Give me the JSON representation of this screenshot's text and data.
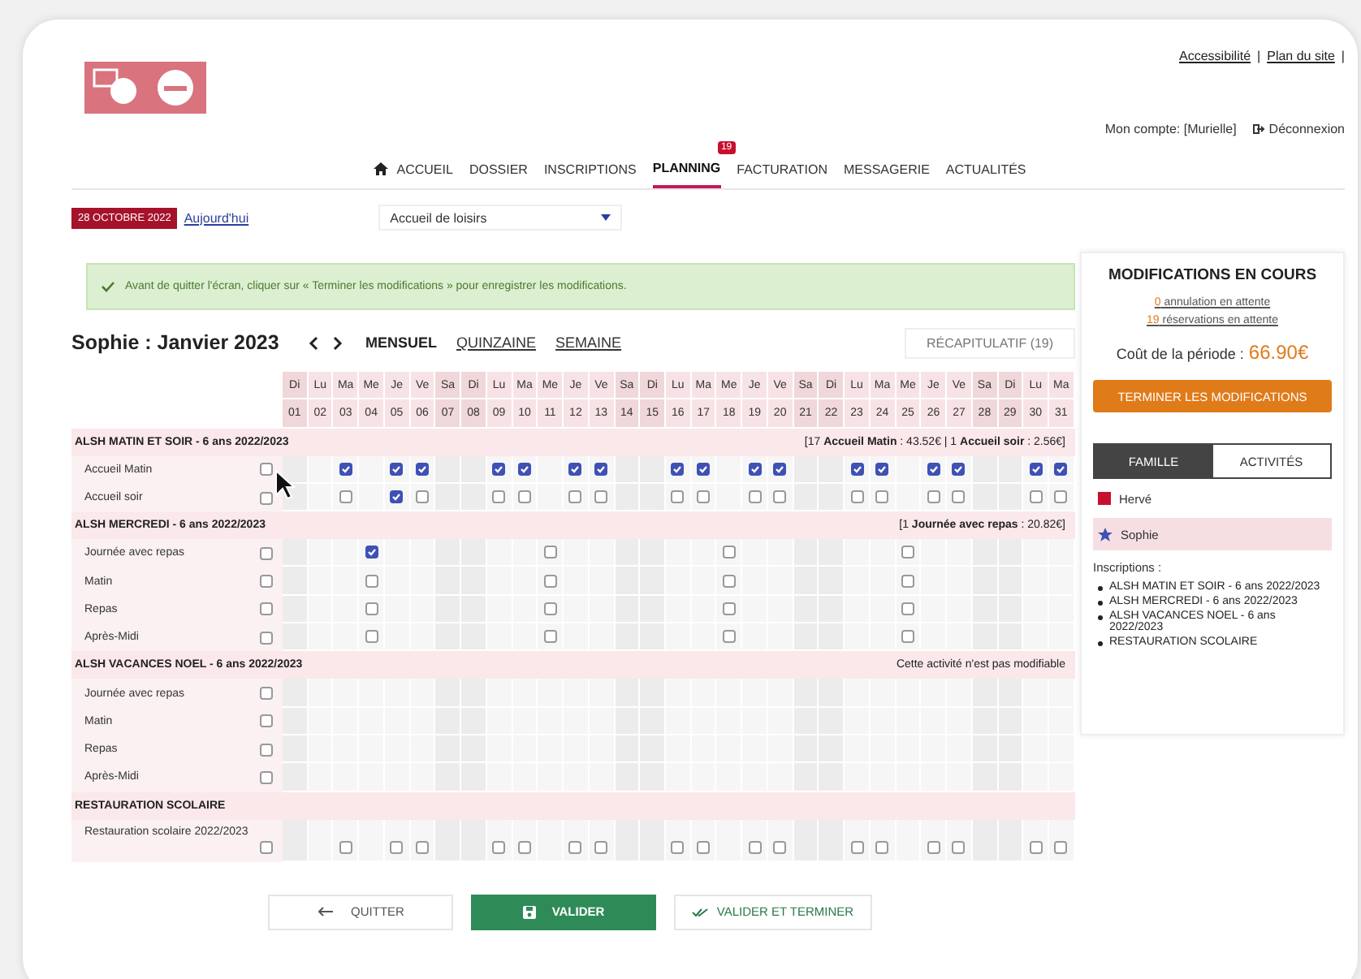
{
  "header": {
    "links": [
      "Accessibilité",
      "Plan du site"
    ],
    "separator": "|",
    "account": "Mon compte: [Murielle]",
    "logout": "Déconnexion"
  },
  "nav": [
    {
      "label": "ACCUEIL",
      "kind": "home",
      "selected": false
    },
    {
      "label": "DOSSIER",
      "kind": "plain",
      "selected": false
    },
    {
      "label": "INSCRIPTIONS",
      "kind": "plain",
      "selected": false
    },
    {
      "label": "PLANNING",
      "kind": "plain",
      "selected": true,
      "badge": "19"
    },
    {
      "label": "FACTURATION",
      "kind": "plain",
      "selected": false
    },
    {
      "label": "MESSAGERIE",
      "kind": "plain",
      "selected": false
    },
    {
      "label": "ACTUALITÉS",
      "kind": "plain",
      "selected": false
    }
  ],
  "toolbar": {
    "date": "28 OCTOBRE 2022",
    "today": "Aujourd'hui",
    "select": "Accueil de loisirs"
  },
  "alert": "Avant de quitter l'écran, cliquer sur « Terminer les modifications » pour enregistrer les modifications.",
  "planner": {
    "title": "Sophie : Janvier 2023",
    "views": [
      {
        "label": "MENSUEL",
        "selected": true
      },
      {
        "label": "QUINZAINE",
        "selected": false
      },
      {
        "label": "SEMAINE",
        "selected": false
      }
    ],
    "summary_button": "RÉCAPITULATIF (19)",
    "days": [
      {
        "weekday": "Di",
        "date": "01",
        "weekend": true
      },
      {
        "weekday": "Lu",
        "date": "02",
        "weekend": false
      },
      {
        "weekday": "Ma",
        "date": "03",
        "weekend": false
      },
      {
        "weekday": "Me",
        "date": "04",
        "weekend": false
      },
      {
        "weekday": "Je",
        "date": "05",
        "weekend": false
      },
      {
        "weekday": "Ve",
        "date": "06",
        "weekend": false
      },
      {
        "weekday": "Sa",
        "date": "07",
        "weekend": true
      },
      {
        "weekday": "Di",
        "date": "08",
        "weekend": true
      },
      {
        "weekday": "Lu",
        "date": "09",
        "weekend": false
      },
      {
        "weekday": "Ma",
        "date": "10",
        "weekend": false
      },
      {
        "weekday": "Me",
        "date": "11",
        "weekend": false
      },
      {
        "weekday": "Je",
        "date": "12",
        "weekend": false
      },
      {
        "weekday": "Ve",
        "date": "13",
        "weekend": false
      },
      {
        "weekday": "Sa",
        "date": "14",
        "weekend": true
      },
      {
        "weekday": "Di",
        "date": "15",
        "weekend": true
      },
      {
        "weekday": "Lu",
        "date": "16",
        "weekend": false
      },
      {
        "weekday": "Ma",
        "date": "17",
        "weekend": false
      },
      {
        "weekday": "Me",
        "date": "18",
        "weekend": false
      },
      {
        "weekday": "Je",
        "date": "19",
        "weekend": false
      },
      {
        "weekday": "Ve",
        "date": "20",
        "weekend": false
      },
      {
        "weekday": "Sa",
        "date": "21",
        "weekend": true
      },
      {
        "weekday": "Di",
        "date": "22",
        "weekend": true
      },
      {
        "weekday": "Lu",
        "date": "23",
        "weekend": false
      },
      {
        "weekday": "Ma",
        "date": "24",
        "weekend": false
      },
      {
        "weekday": "Me",
        "date": "25",
        "weekend": false
      },
      {
        "weekday": "Je",
        "date": "26",
        "weekend": false
      },
      {
        "weekday": "Ve",
        "date": "27",
        "weekend": false
      },
      {
        "weekday": "Sa",
        "date": "28",
        "weekend": true
      },
      {
        "weekday": "Di",
        "date": "29",
        "weekend": true
      },
      {
        "weekday": "Lu",
        "date": "30",
        "weekend": false
      },
      {
        "weekday": "Ma",
        "date": "31",
        "weekend": false
      }
    ],
    "groups": [
      {
        "title": "ALSH MATIN ET SOIR - 6 ans 2022/2023",
        "note": "[17 **Accueil Matin** : 43.52€ | 1 **Accueil soir** : 2.56€]",
        "rows": [
          {
            "label": "Accueil Matin",
            "all": false,
            "cells": [
              {
                "kind": "blank"
              },
              {
                "kind": "blank"
              },
              {
                "kind": "box",
                "checked": true
              },
              {
                "kind": "blank"
              },
              {
                "kind": "box",
                "checked": true
              },
              {
                "kind": "box",
                "checked": true
              },
              {
                "kind": "blank"
              },
              {
                "kind": "blank"
              },
              {
                "kind": "box",
                "checked": true
              },
              {
                "kind": "box",
                "checked": true
              },
              {
                "kind": "blank"
              },
              {
                "kind": "box",
                "checked": true
              },
              {
                "kind": "box",
                "checked": true
              },
              {
                "kind": "blank"
              },
              {
                "kind": "blank"
              },
              {
                "kind": "box",
                "checked": true
              },
              {
                "kind": "box",
                "checked": true
              },
              {
                "kind": "blank"
              },
              {
                "kind": "box",
                "checked": true
              },
              {
                "kind": "box",
                "checked": true
              },
              {
                "kind": "blank"
              },
              {
                "kind": "blank"
              },
              {
                "kind": "box",
                "checked": true
              },
              {
                "kind": "box",
                "checked": true
              },
              {
                "kind": "blank"
              },
              {
                "kind": "box",
                "checked": true
              },
              {
                "kind": "box",
                "checked": true
              },
              {
                "kind": "blank"
              },
              {
                "kind": "blank"
              },
              {
                "kind": "box",
                "checked": true
              },
              {
                "kind": "box",
                "checked": true
              }
            ]
          },
          {
            "label": "Accueil soir",
            "all": false,
            "cells": [
              {
                "kind": "blank"
              },
              {
                "kind": "blank"
              },
              {
                "kind": "box",
                "checked": false
              },
              {
                "kind": "blank"
              },
              {
                "kind": "box",
                "checked": true
              },
              {
                "kind": "box",
                "checked": false
              },
              {
                "kind": "blank"
              },
              {
                "kind": "blank"
              },
              {
                "kind": "box",
                "checked": false
              },
              {
                "kind": "box",
                "checked": false
              },
              {
                "kind": "blank"
              },
              {
                "kind": "box",
                "checked": false
              },
              {
                "kind": "box",
                "checked": false
              },
              {
                "kind": "blank"
              },
              {
                "kind": "blank"
              },
              {
                "kind": "box",
                "checked": false
              },
              {
                "kind": "box",
                "checked": false
              },
              {
                "kind": "blank"
              },
              {
                "kind": "box",
                "checked": false
              },
              {
                "kind": "box",
                "checked": false
              },
              {
                "kind": "blank"
              },
              {
                "kind": "blank"
              },
              {
                "kind": "box",
                "checked": false
              },
              {
                "kind": "box",
                "checked": false
              },
              {
                "kind": "blank"
              },
              {
                "kind": "box",
                "checked": false
              },
              {
                "kind": "box",
                "checked": false
              },
              {
                "kind": "blank"
              },
              {
                "kind": "blank"
              },
              {
                "kind": "box",
                "checked": false
              },
              {
                "kind": "box",
                "checked": false
              }
            ]
          }
        ]
      },
      {
        "title": "ALSH MERCREDI - 6 ans 2022/2023",
        "note": "[1 **Journée avec repas** : 20.82€]",
        "rows": [
          {
            "label": "Journée avec repas",
            "all": false,
            "cells": [
              {
                "kind": "blank"
              },
              {
                "kind": "blank"
              },
              {
                "kind": "blank"
              },
              {
                "kind": "box",
                "checked": true
              },
              {
                "kind": "blank"
              },
              {
                "kind": "blank"
              },
              {
                "kind": "blank"
              },
              {
                "kind": "blank"
              },
              {
                "kind": "blank"
              },
              {
                "kind": "blank"
              },
              {
                "kind": "box",
                "checked": false
              },
              {
                "kind": "blank"
              },
              {
                "kind": "blank"
              },
              {
                "kind": "blank"
              },
              {
                "kind": "blank"
              },
              {
                "kind": "blank"
              },
              {
                "kind": "blank"
              },
              {
                "kind": "box",
                "checked": false
              },
              {
                "kind": "blank"
              },
              {
                "kind": "blank"
              },
              {
                "kind": "blank"
              },
              {
                "kind": "blank"
              },
              {
                "kind": "blank"
              },
              {
                "kind": "blank"
              },
              {
                "kind": "box",
                "checked": false
              },
              {
                "kind": "blank"
              },
              {
                "kind": "blank"
              },
              {
                "kind": "blank"
              },
              {
                "kind": "blank"
              },
              {
                "kind": "blank"
              },
              {
                "kind": "blank"
              }
            ]
          },
          {
            "label": "Matin",
            "all": false,
            "cells": [
              {
                "kind": "blank"
              },
              {
                "kind": "blank"
              },
              {
                "kind": "blank"
              },
              {
                "kind": "box",
                "checked": false
              },
              {
                "kind": "blank"
              },
              {
                "kind": "blank"
              },
              {
                "kind": "blank"
              },
              {
                "kind": "blank"
              },
              {
                "kind": "blank"
              },
              {
                "kind": "blank"
              },
              {
                "kind": "box",
                "checked": false
              },
              {
                "kind": "blank"
              },
              {
                "kind": "blank"
              },
              {
                "kind": "blank"
              },
              {
                "kind": "blank"
              },
              {
                "kind": "blank"
              },
              {
                "kind": "blank"
              },
              {
                "kind": "box",
                "checked": false
              },
              {
                "kind": "blank"
              },
              {
                "kind": "blank"
              },
              {
                "kind": "blank"
              },
              {
                "kind": "blank"
              },
              {
                "kind": "blank"
              },
              {
                "kind": "blank"
              },
              {
                "kind": "box",
                "checked": false
              },
              {
                "kind": "blank"
              },
              {
                "kind": "blank"
              },
              {
                "kind": "blank"
              },
              {
                "kind": "blank"
              },
              {
                "kind": "blank"
              },
              {
                "kind": "blank"
              }
            ]
          },
          {
            "label": "Repas",
            "all": false,
            "cells": [
              {
                "kind": "blank"
              },
              {
                "kind": "blank"
              },
              {
                "kind": "blank"
              },
              {
                "kind": "box",
                "checked": false
              },
              {
                "kind": "blank"
              },
              {
                "kind": "blank"
              },
              {
                "kind": "blank"
              },
              {
                "kind": "blank"
              },
              {
                "kind": "blank"
              },
              {
                "kind": "blank"
              },
              {
                "kind": "box",
                "checked": false
              },
              {
                "kind": "blank"
              },
              {
                "kind": "blank"
              },
              {
                "kind": "blank"
              },
              {
                "kind": "blank"
              },
              {
                "kind": "blank"
              },
              {
                "kind": "blank"
              },
              {
                "kind": "box",
                "checked": false
              },
              {
                "kind": "blank"
              },
              {
                "kind": "blank"
              },
              {
                "kind": "blank"
              },
              {
                "kind": "blank"
              },
              {
                "kind": "blank"
              },
              {
                "kind": "blank"
              },
              {
                "kind": "box",
                "checked": false
              },
              {
                "kind": "blank"
              },
              {
                "kind": "blank"
              },
              {
                "kind": "blank"
              },
              {
                "kind": "blank"
              },
              {
                "kind": "blank"
              },
              {
                "kind": "blank"
              }
            ]
          },
          {
            "label": "Après-Midi",
            "all": false,
            "cells": [
              {
                "kind": "blank"
              },
              {
                "kind": "blank"
              },
              {
                "kind": "blank"
              },
              {
                "kind": "box",
                "checked": false
              },
              {
                "kind": "blank"
              },
              {
                "kind": "blank"
              },
              {
                "kind": "blank"
              },
              {
                "kind": "blank"
              },
              {
                "kind": "blank"
              },
              {
                "kind": "blank"
              },
              {
                "kind": "box",
                "checked": false
              },
              {
                "kind": "blank"
              },
              {
                "kind": "blank"
              },
              {
                "kind": "blank"
              },
              {
                "kind": "blank"
              },
              {
                "kind": "blank"
              },
              {
                "kind": "blank"
              },
              {
                "kind": "box",
                "checked": false
              },
              {
                "kind": "blank"
              },
              {
                "kind": "blank"
              },
              {
                "kind": "blank"
              },
              {
                "kind": "blank"
              },
              {
                "kind": "blank"
              },
              {
                "kind": "blank"
              },
              {
                "kind": "box",
                "checked": false
              },
              {
                "kind": "blank"
              },
              {
                "kind": "blank"
              },
              {
                "kind": "blank"
              },
              {
                "kind": "blank"
              },
              {
                "kind": "blank"
              },
              {
                "kind": "blank"
              }
            ]
          }
        ]
      },
      {
        "title": "ALSH VACANCES NOEL - 6 ans 2022/2023",
        "note": "Cette activité n'est pas modifiable",
        "rows": [
          {
            "label": "Journée avec repas",
            "all": false
          },
          {
            "label": "Matin",
            "all": false
          },
          {
            "label": "Repas",
            "all": false
          },
          {
            "label": "Après-Midi",
            "all": false
          }
        ]
      },
      {
        "title": "RESTAURATION SCOLAIRE",
        "rows": [
          {
            "label": "Restauration scolaire 2022/2023",
            "all": false,
            "cells": [
              {
                "kind": "blank"
              },
              {
                "kind": "blank"
              },
              {
                "kind": "box",
                "checked": false
              },
              {
                "kind": "blank"
              },
              {
                "kind": "box",
                "checked": false
              },
              {
                "kind": "box",
                "checked": false
              },
              {
                "kind": "blank"
              },
              {
                "kind": "blank"
              },
              {
                "kind": "box",
                "checked": false
              },
              {
                "kind": "box",
                "checked": false
              },
              {
                "kind": "blank"
              },
              {
                "kind": "box",
                "checked": false
              },
              {
                "kind": "box",
                "checked": false
              },
              {
                "kind": "blank"
              },
              {
                "kind": "blank"
              },
              {
                "kind": "box",
                "checked": false
              },
              {
                "kind": "box",
                "checked": false
              },
              {
                "kind": "blank"
              },
              {
                "kind": "box",
                "checked": false
              },
              {
                "kind": "box",
                "checked": false
              },
              {
                "kind": "blank"
              },
              {
                "kind": "blank"
              },
              {
                "kind": "box",
                "checked": false
              },
              {
                "kind": "box",
                "checked": false
              },
              {
                "kind": "blank"
              },
              {
                "kind": "box",
                "checked": false
              },
              {
                "kind": "box",
                "checked": false
              },
              {
                "kind": "blank"
              },
              {
                "kind": "blank"
              },
              {
                "kind": "box",
                "checked": false
              },
              {
                "kind": "box",
                "checked": false
              }
            ]
          }
        ]
      }
    ]
  },
  "side": {
    "title": "MODIFICATIONS EN COURS",
    "pending": [
      {
        "count": "0",
        "text": "annulation en attente"
      },
      {
        "count": "19",
        "text": "réservations en attente"
      }
    ],
    "cost_label": "Coût de la période :",
    "cost": "66.90€",
    "finish": "TERMINER LES MODIFICATIONS",
    "tabs": [
      {
        "label": "FAMILLE",
        "selected": true
      },
      {
        "label": "ACTIVITÉS",
        "selected": false
      }
    ],
    "members": [
      {
        "name": "Hervé",
        "kind": "square",
        "color": "#c8102e",
        "selected": false
      },
      {
        "name": "Sophie",
        "kind": "star",
        "color": "#3f51b5",
        "selected": true
      }
    ],
    "inscriptions_label": "Inscriptions :",
    "inscriptions": [
      "ALSH MATIN ET SOIR - 6 ans 2022/2023",
      "ALSH MERCREDI - 6 ans 2022/2023",
      "ALSH VACANCES NOEL - 6 ans 2022/2023",
      "RESTAURATION SCOLAIRE"
    ]
  },
  "buttons": [
    {
      "label": "QUITTER",
      "kind": "back"
    },
    {
      "label": "VALIDER",
      "kind": "save"
    },
    {
      "label": "VALIDER ET TERMINER",
      "kind": "finish"
    }
  ]
}
